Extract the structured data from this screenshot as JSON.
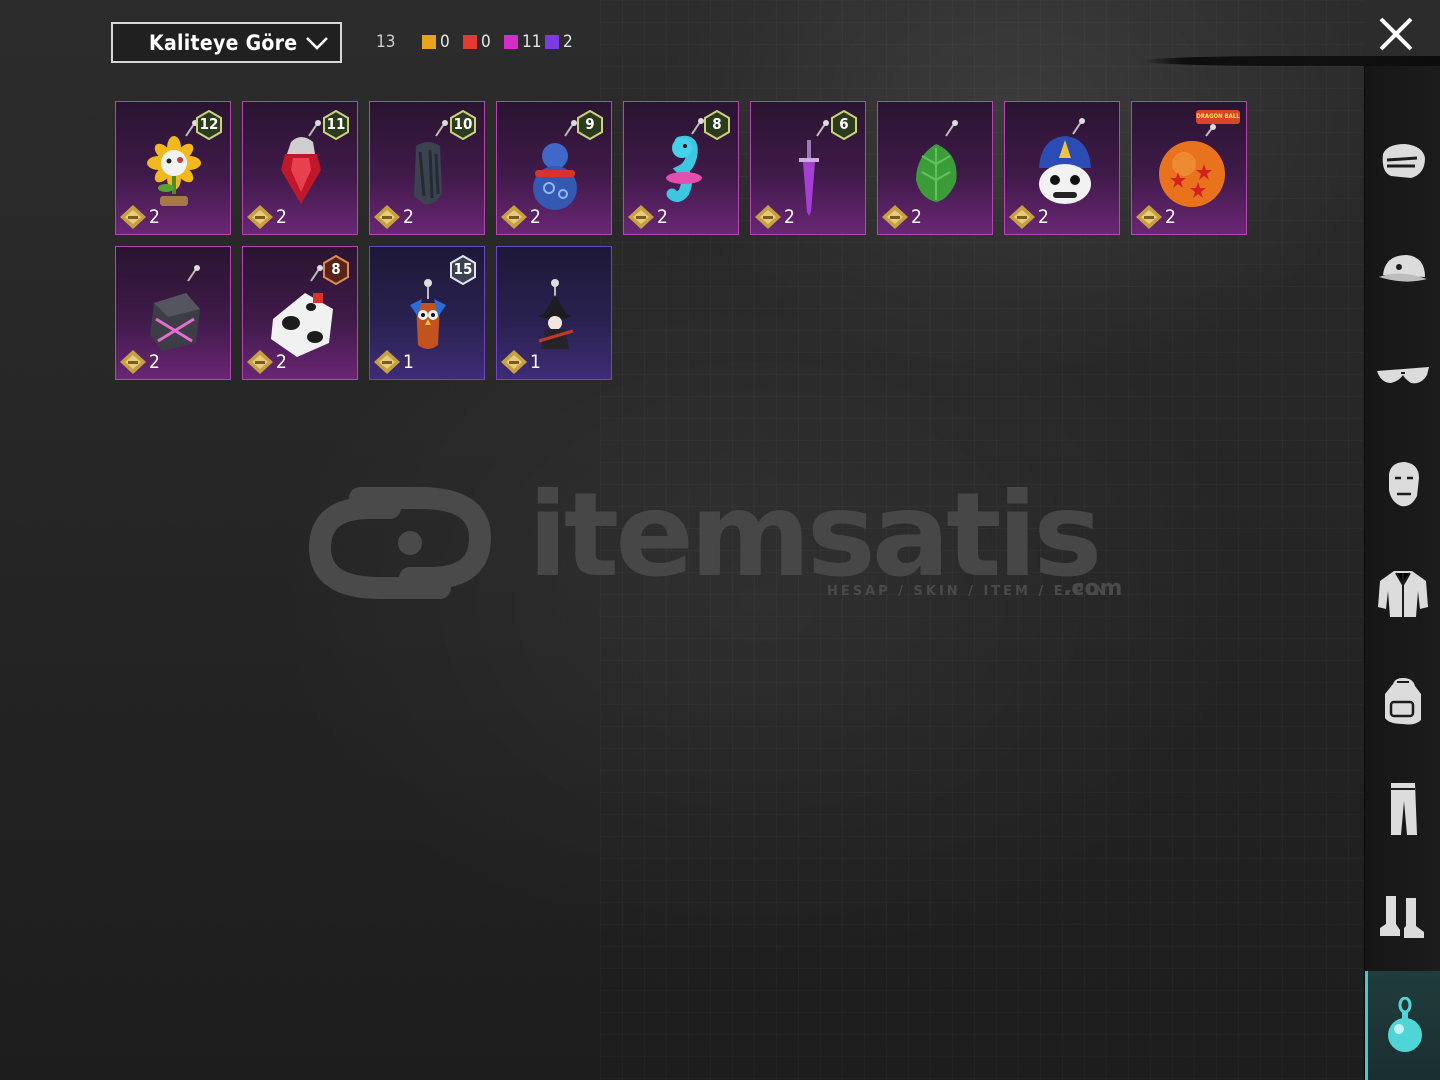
{
  "sort": {
    "label": "Kaliteye Göre"
  },
  "summary": {
    "total": "13",
    "qualities": [
      {
        "color": "#e8a21c",
        "count": "0"
      },
      {
        "color": "#e43a32",
        "count": "0"
      },
      {
        "color": "#d42dc9",
        "count": "11"
      },
      {
        "color": "#7c3be2",
        "count": "2"
      }
    ]
  },
  "items": [
    {
      "name": "sunflower",
      "level": "12",
      "count": "2",
      "rarity": "magenta"
    },
    {
      "name": "red-gem",
      "level": "11",
      "count": "2",
      "rarity": "magenta"
    },
    {
      "name": "dark-glove",
      "level": "10",
      "count": "2",
      "rarity": "magenta"
    },
    {
      "name": "blue-gourd",
      "level": "9",
      "count": "2",
      "rarity": "magenta"
    },
    {
      "name": "seahorse",
      "level": "8",
      "count": "2",
      "rarity": "magenta"
    },
    {
      "name": "purple-dagger",
      "level": "6",
      "count": "2",
      "rarity": "magenta"
    },
    {
      "name": "green-leaf-egg",
      "level": "",
      "count": "2",
      "rarity": "magenta"
    },
    {
      "name": "police-mascot",
      "level": "",
      "count": "2",
      "rarity": "magenta"
    },
    {
      "name": "dragon-ball",
      "level": "",
      "count": "2",
      "rarity": "magenta",
      "logo": "DRAGON BALL"
    },
    {
      "name": "dark-cube",
      "level": "",
      "count": "2",
      "rarity": "magenta"
    },
    {
      "name": "cow-cube",
      "level": "8",
      "count": "2",
      "rarity": "magenta"
    },
    {
      "name": "owl-charm",
      "level": "15",
      "count": "1",
      "rarity": "purple"
    },
    {
      "name": "witch-charm",
      "level": "",
      "count": "1",
      "rarity": "purple"
    }
  ],
  "watermark": {
    "brand": "itemsatis",
    "tagline": "HESAP / SKIN / ITEM / E-PIN",
    "tld": ".com"
  },
  "sidebar": [
    {
      "icon": "mask-icon"
    },
    {
      "icon": "cap-icon"
    },
    {
      "icon": "glasses-icon"
    },
    {
      "icon": "face-icon"
    },
    {
      "icon": "jacket-icon"
    },
    {
      "icon": "backpack-icon"
    },
    {
      "icon": "pants-icon"
    },
    {
      "icon": "boots-icon"
    },
    {
      "icon": "pendant-icon",
      "active": true
    }
  ]
}
